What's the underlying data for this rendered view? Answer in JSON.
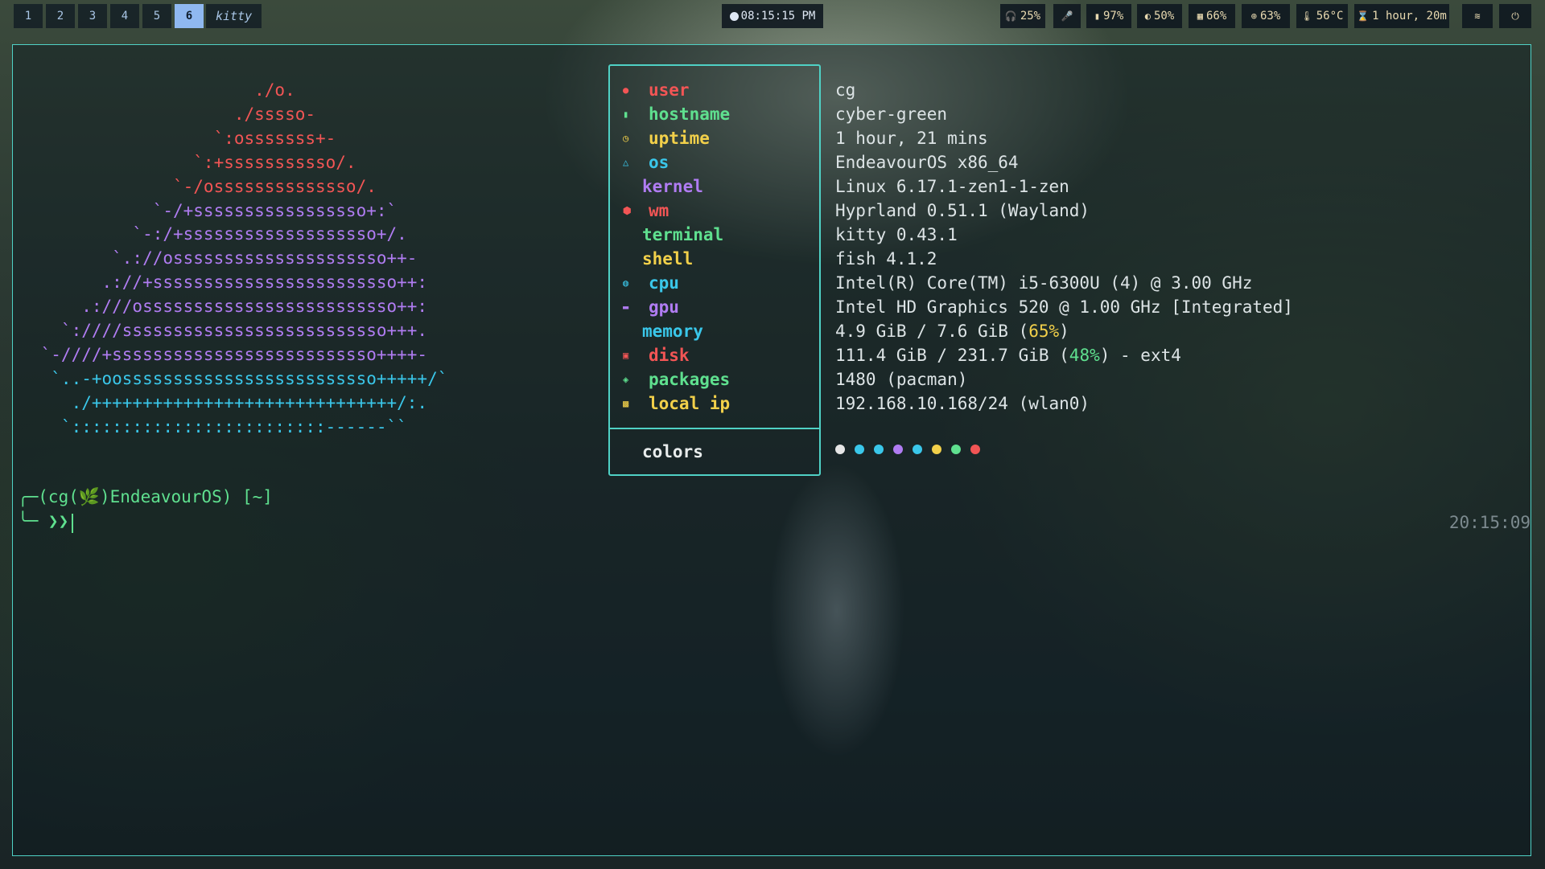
{
  "topbar": {
    "workspaces": [
      "1",
      "2",
      "3",
      "4",
      "5",
      "6"
    ],
    "active_workspace": "6",
    "window_title": "kitty",
    "clock": "08:15:15 PM",
    "stats": {
      "volume": "25%",
      "mic": "",
      "battery": "97%",
      "brightness": "50%",
      "memory": "66%",
      "cpu": "63%",
      "temp": "56°C",
      "uptime": "1 hour, 20m"
    }
  },
  "ascii_logo": [
    "                      ./o.",
    "                    ./sssso-",
    "                  `:osssssss+-",
    "                `:+sssssssssso/.",
    "              `-/ossssssssssssso/.",
    "            `-/+sssssssssssssssso+:`",
    "          `-:/+sssssssssssssssssso+/.",
    "        `.://osssssssssssssssssssso++-",
    "       .://+ssssssssssssssssssssssso++:",
    "     .:///osssssssssssssssssssssssso++:",
    "   `:////ssssssssssssssssssssssssso+++.",
    " `-////+ssssssssssssssssssssssssso++++-",
    "  `..-+oosssssssssssssssssssssssso+++++/`",
    "    ./++++++++++++++++++++++++++++++/:.",
    "   `:::::::::::::::::::::::::------``"
  ],
  "fetch": {
    "rows": [
      {
        "label": "user",
        "value": "cg",
        "color": "#f25555",
        "icon": "user-icon"
      },
      {
        "label": "hostname",
        "value": "cyber-green",
        "color": "#5fe08f",
        "icon": "server-icon"
      },
      {
        "label": "uptime",
        "value": "1 hour, 21 mins",
        "color": "#f2d04a",
        "icon": "clock-icon"
      },
      {
        "label": "os",
        "value": "EndeavourOS x86_64",
        "color": "#3ac7ea",
        "icon": "linux-icon"
      },
      {
        "label": "kernel",
        "value": "Linux 6.17.1-zen1-1-zen",
        "color": "#b07cf2",
        "icon": ""
      },
      {
        "label": "wm",
        "value": "Hyprland 0.51.1 (Wayland)",
        "color": "#f25555",
        "icon": "cube-icon"
      },
      {
        "label": "terminal",
        "value": "kitty 0.43.1",
        "color": "#5fe08f",
        "icon": ""
      },
      {
        "label": "shell",
        "value": "fish 4.1.2",
        "color": "#f2d04a",
        "icon": ""
      },
      {
        "label": "cpu",
        "value": "Intel(R) Core(TM) i5-6300U (4) @ 3.00 GHz",
        "color": "#3ac7ea",
        "icon": "cpu-icon"
      },
      {
        "label": "gpu",
        "value": "Intel HD Graphics 520 @ 1.00 GHz [Integrated]",
        "color": "#b07cf2",
        "icon": "gpu-icon"
      },
      {
        "label": "memory",
        "value_prefix": "4.9 GiB / 7.6 GiB (",
        "value_hl": "65%",
        "value_suffix": ")",
        "hl_color": "#f2d04a",
        "color": "#3ac7ea",
        "icon": ""
      },
      {
        "label": "disk",
        "value_prefix": "111.4 GiB / 231.7 GiB (",
        "value_hl": "48%",
        "value_suffix": ") - ext4",
        "hl_color": "#5fe08f",
        "color": "#f25555",
        "icon": "disk-icon"
      },
      {
        "label": "packages",
        "value": "1480 (pacman)",
        "color": "#5fe08f",
        "icon": "package-icon"
      },
      {
        "label": "local ip",
        "value": "192.168.10.168/24 (wlan0)",
        "color": "#f2d04a",
        "icon": "network-icon"
      }
    ],
    "colors_label": "colors",
    "palette": [
      "#e6e6e6",
      "#3ac7ea",
      "#3ac7ea",
      "#b07cf2",
      "#3ac7ea",
      "#f2d04a",
      "#5fe08f",
      "#f25555"
    ]
  },
  "prompt": {
    "line1": "╭─(cg(🌿)EndeavourOS) [~]",
    "line2": "╰─ ❯❯ ",
    "right_time": "20:15:09"
  }
}
